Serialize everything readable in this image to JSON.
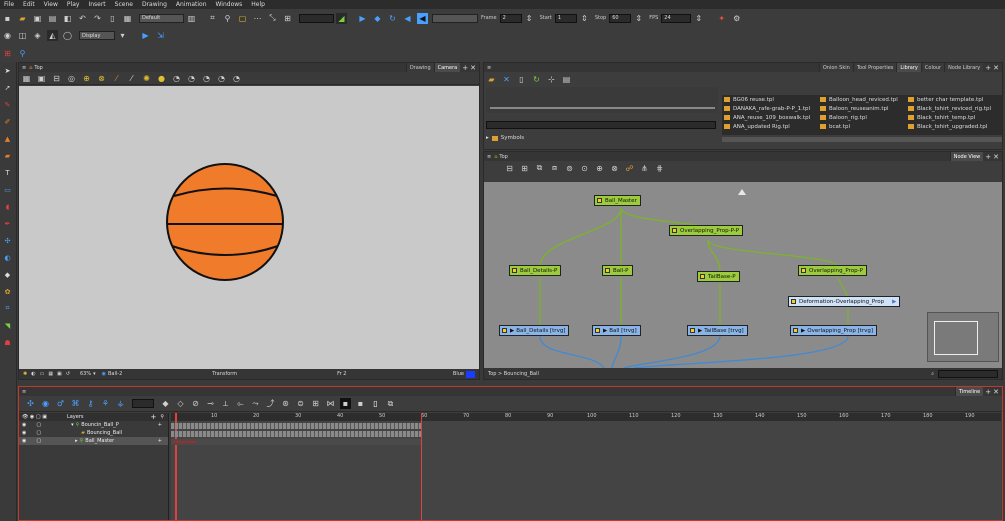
{
  "menu": [
    "File",
    "Edit",
    "View",
    "Play",
    "Insert",
    "Scene",
    "Drawing",
    "Animation",
    "Windows",
    "Help"
  ],
  "toolbar": {
    "workspace_select": "Default",
    "display_select": "Display",
    "frame_label": "Frame",
    "frame_value": "2",
    "start_label": "Start",
    "start_value": "1",
    "stop_label": "Stop",
    "stop_value": "60",
    "fps_label": "FPS",
    "fps_value": "24"
  },
  "camera_view": {
    "title": "Top",
    "tabs": [
      "Drawing",
      "Camera"
    ],
    "active_tab": "Camera",
    "status": {
      "zoom": "63%",
      "layer": "Ball-2",
      "mode": "Transform",
      "frame": "Fr 2",
      "color_name": "Blue"
    }
  },
  "library": {
    "tabs": [
      "Onion Skin",
      "Tool Properties",
      "Library",
      "Colour",
      "Node Library"
    ],
    "active_tab": "Library",
    "tree_item": "Symbols",
    "col1": [
      "BG06 reuse.tpl",
      "DANAKA_rafe-grab-P-P_1.tpl",
      "ANA_reuse_109_boxwalk.tpl",
      "ANA_updated Rig.tpl"
    ],
    "col2": [
      "Balloon_head_reviced.tpl",
      "Baloon_reuseanim.tpl",
      "Baloon_rig.tpl",
      "bcat.tpl"
    ],
    "col3": [
      "better char template.tpl",
      "Black_tshirt_reviced_rig.tpl",
      "Black_tshirt_temp.tpl",
      "Black_tshirt_upgraded.tpl"
    ]
  },
  "node_view": {
    "title": "Top",
    "tab": "Node View",
    "breadcrumb": "Top > Bouncing_Ball",
    "nodes": {
      "ball_master": "Ball_Master",
      "overlapping_prop_pp": "Overlapping_Prop-P-P",
      "ball_details_p": "Ball_Details-P",
      "ball_p": "Ball-P",
      "tailbase_p": "TailBase-P",
      "overlapping_prop_p": "Overlapping_Prop-P",
      "deformation": "Deformation-Overlapping_Prop",
      "ball_details_trvg": "Ball_Details [trvg]",
      "ball_trvg": "Ball [trvg]",
      "tailbase_trvg": "TailBase [trvg]",
      "overlapping_prop_trvg": "Overlapping_Prop [trvg]"
    }
  },
  "timeline": {
    "tab": "Timeline",
    "layers_header": "Layers",
    "layers": [
      "Bouncin_Ball_P",
      "Bouncing_Ball",
      "Ball_Master"
    ],
    "ticks": [
      "10",
      "20",
      "30",
      "40",
      "50",
      "60",
      "70",
      "80",
      "90",
      "100",
      "110",
      "120",
      "130",
      "140",
      "150",
      "160",
      "170",
      "180",
      "190"
    ]
  },
  "colors": {
    "ball": "#f07b2a",
    "node_green": "#9ccc3c",
    "node_blue": "#8ab4e8",
    "timeline_border": "#c0392b"
  }
}
